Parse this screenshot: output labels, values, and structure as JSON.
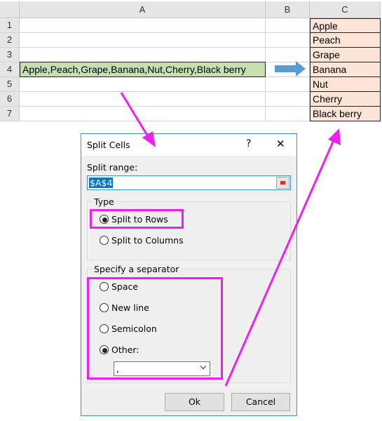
{
  "sheet": {
    "columns": [
      "A",
      "B",
      "C"
    ],
    "rows": [
      "1",
      "2",
      "3",
      "4",
      "5",
      "6",
      "7"
    ],
    "a4": "Apple,Peach,Grape,Banana,Nut,Cherry,Black berry",
    "c_values": [
      "Apple",
      "Peach",
      "Grape",
      "Banana",
      "Nut",
      "Cherry",
      "Black berry"
    ],
    "colors": {
      "a4_fill": "#c6e0b4",
      "c_fill": "#fce4d6",
      "arrow": "#5b9bd5",
      "callout": "#f01ef0"
    }
  },
  "dialog": {
    "title": "Split Cells",
    "help": "?",
    "close": "✕",
    "range_label": "Split range:",
    "range_value": "$A$4",
    "type_label": "Type",
    "type_options": [
      {
        "label": "Split to Rows",
        "checked": true
      },
      {
        "label": "Split to Columns",
        "checked": false
      }
    ],
    "sep_label": "Specify a separator",
    "sep_options": [
      {
        "label": "Space",
        "checked": false
      },
      {
        "label": "New line",
        "checked": false
      },
      {
        "label": "Semicolon",
        "checked": false
      },
      {
        "label": "Other:",
        "checked": true
      }
    ],
    "other_value": ",",
    "ok": "Ok",
    "cancel": "Cancel"
  }
}
